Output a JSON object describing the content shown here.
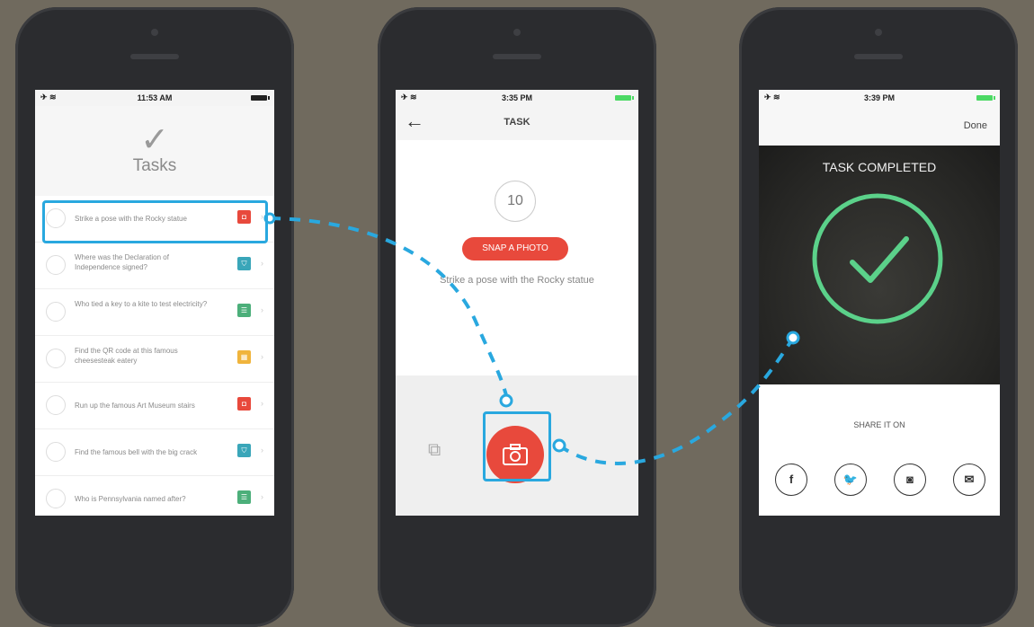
{
  "colors": {
    "accent_blue": "#29a8df",
    "red": "#e8493c",
    "teal": "#3aa6b9",
    "green": "#4caf7a",
    "yellow": "#f0b43c",
    "success_green": "#5bd18a"
  },
  "phone1": {
    "status_time": "11:53 AM",
    "title": "Tasks",
    "tasks": [
      {
        "text": "Strike a pose with the Rocky statue",
        "icon": "camera-icon",
        "color": "#e8493c"
      },
      {
        "text": "Where was the Declaration of Independence signed?",
        "icon": "shield-icon",
        "color": "#3aa6b9"
      },
      {
        "text": "Who tied a key to a kite to test electricity?",
        "icon": "list-icon",
        "color": "#4caf7a"
      },
      {
        "text": "Find the QR code at this famous cheesesteak eatery",
        "icon": "qr-icon",
        "color": "#f0b43c"
      },
      {
        "text": "Run up the famous Art Museum stairs",
        "icon": "camera-icon",
        "color": "#e8493c"
      },
      {
        "text": "Find the famous bell with the big crack",
        "icon": "shield-icon",
        "color": "#3aa6b9"
      },
      {
        "text": "Who is Pennsylvania named after?",
        "icon": "list-icon",
        "color": "#4caf7a"
      }
    ]
  },
  "phone2": {
    "status_time": "3:35 PM",
    "nav_title": "TASK",
    "counter": "10",
    "action_label": "SNAP A PHOTO",
    "description": "Strike a pose with the Rocky statue"
  },
  "phone3": {
    "status_time": "3:39 PM",
    "done_label": "Done",
    "completed_title": "TASK COMPLETED",
    "share_label": "SHARE IT ON",
    "social": [
      {
        "name": "facebook-icon",
        "glyph": "f"
      },
      {
        "name": "twitter-icon",
        "glyph": "🐦"
      },
      {
        "name": "instagram-icon",
        "glyph": "◙"
      },
      {
        "name": "email-icon",
        "glyph": "✉"
      }
    ]
  }
}
